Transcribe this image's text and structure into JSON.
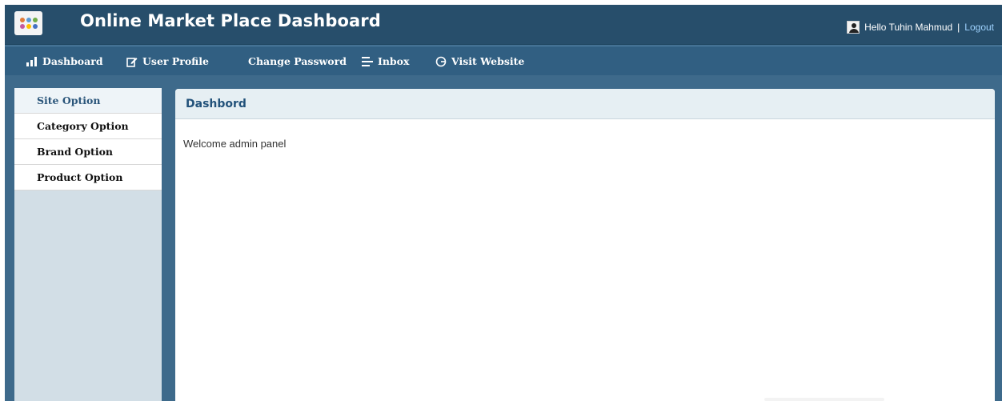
{
  "header": {
    "title": "Online Market Place Dashboard",
    "logo_icon": "people-logo-icon",
    "greeting": "Hello Tuhin Mahmud",
    "separator": "|",
    "logout_label": "Logout",
    "user_icon": "user-avatar-icon"
  },
  "nav": {
    "items": [
      {
        "label": "Dashboard",
        "icon": "bar-chart-icon"
      },
      {
        "label": "User Profile",
        "icon": "edit-icon"
      },
      {
        "label": "Change Password",
        "icon": ""
      },
      {
        "label": "Inbox",
        "icon": "list-icon"
      },
      {
        "label": "Visit Website",
        "icon": "globe-icon"
      }
    ]
  },
  "sidebar": {
    "items": [
      {
        "label": "Site Option",
        "active": true
      },
      {
        "label": "Category Option"
      },
      {
        "label": "Brand Option"
      },
      {
        "label": "Product Option"
      }
    ]
  },
  "main": {
    "heading": "Dashbord",
    "message": "Welcome admin panel"
  },
  "colors": {
    "header_bg": "#274e6b",
    "nav_bg": "#315f82",
    "frame_bg": "#3e6a8b",
    "sidebar_bg": "#d2dee6",
    "panel_head_bg": "#e6eff3",
    "heading_text": "#22527a",
    "link": "#9fd3ff"
  }
}
